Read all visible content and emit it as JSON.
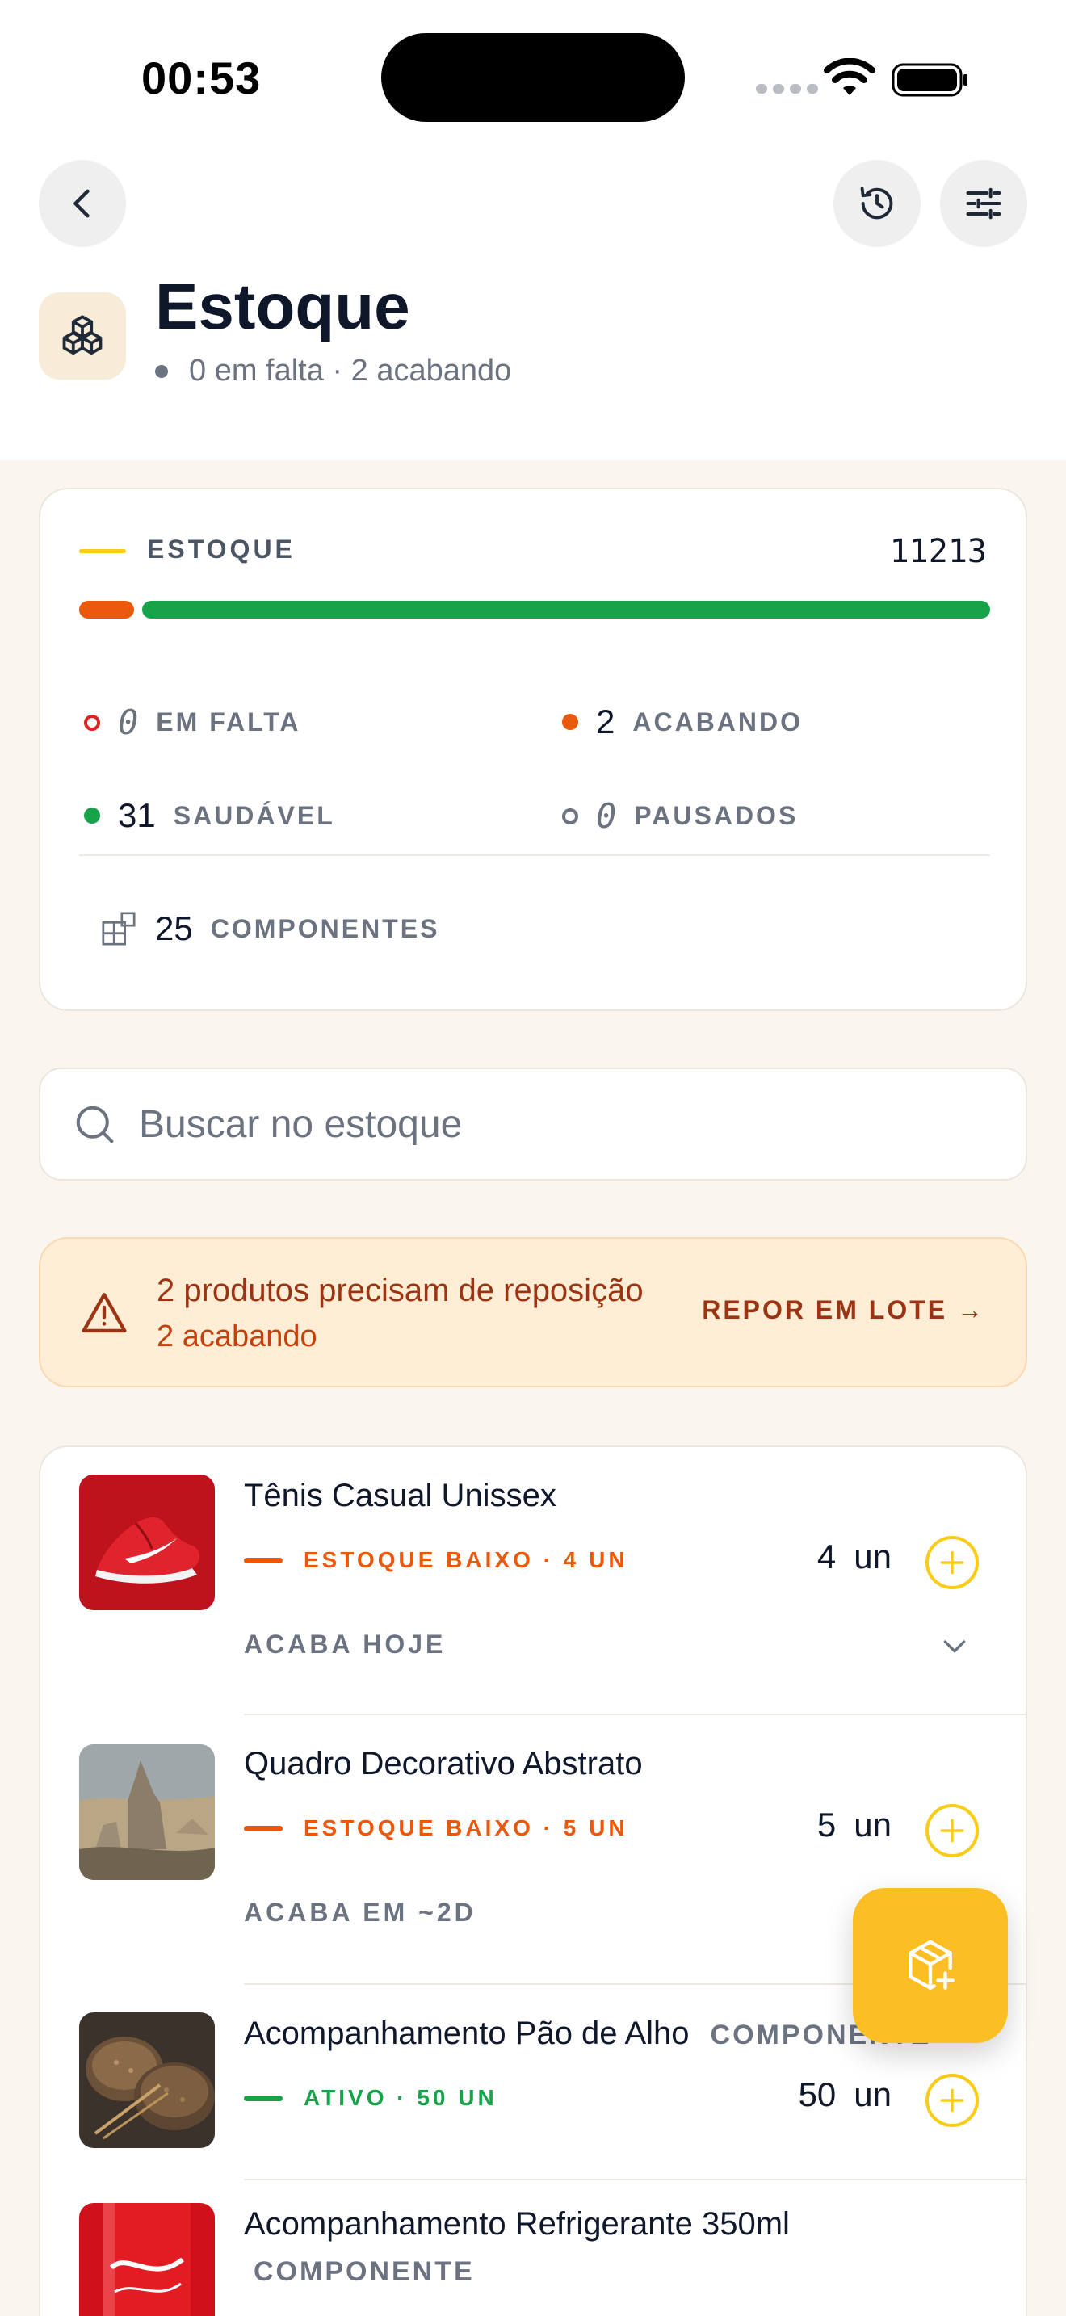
{
  "status_bar": {
    "time": "00:53"
  },
  "header": {
    "title": "Estoque",
    "subtitle": "0 em falta · 2 acabando"
  },
  "summary": {
    "label": "ESTOQUE",
    "total": "11213",
    "bar": {
      "low_fraction": 0.06,
      "healthy_fraction": 0.94
    },
    "stats": {
      "missing": {
        "value": "0",
        "label": "EM FALTA",
        "color": "#dc2626"
      },
      "ending": {
        "value": "2",
        "label": "ACABANDO",
        "color": "#ea580c"
      },
      "healthy": {
        "value": "31",
        "label": "SAUDÁVEL",
        "color": "#16a34a"
      },
      "paused": {
        "value": "0",
        "label": "PAUSADOS",
        "color": "#6b7280"
      }
    },
    "components": {
      "value": "25",
      "label": "COMPONENTES"
    }
  },
  "search": {
    "placeholder": "Buscar no estoque",
    "value": ""
  },
  "alert": {
    "title": "2 produtos precisam de reposição",
    "subtitle": "2 acabando",
    "action": "REPOR EM LOTE →"
  },
  "items": [
    {
      "name": "Tênis Casual Unissex",
      "status": "ESTOQUE BAIXO · 4 UN",
      "status_color": "#ea580c",
      "qty": "4",
      "unit": "un",
      "ends": "ACABA HOJE"
    },
    {
      "name": "Quadro Decorativo Abstrato",
      "status": "ESTOQUE BAIXO · 5 UN",
      "status_color": "#ea580c",
      "qty": "5",
      "unit": "un",
      "ends": "ACABA EM ~2D"
    },
    {
      "name": "Acompanhamento Pão de Alho",
      "tag": "COMPONENTE",
      "status": "ATIVO · 50 UN",
      "status_color": "#16a34a",
      "qty": "50",
      "unit": "un"
    },
    {
      "name": "Acompanhamento Refrigerante 350ml",
      "tag": "COMPONENTE"
    }
  ],
  "colors": {
    "accent": "#facc15",
    "background": "#faf6ef",
    "warning": "#ea580c",
    "success": "#16a34a"
  },
  "icons": {
    "back": "chevron-left-icon",
    "history": "history-icon",
    "filters": "sliders-icon",
    "app": "boxes-icon",
    "search": "search-icon",
    "alert": "warning-triangle-icon",
    "add": "plus-circle-icon",
    "fab": "package-plus-icon"
  }
}
